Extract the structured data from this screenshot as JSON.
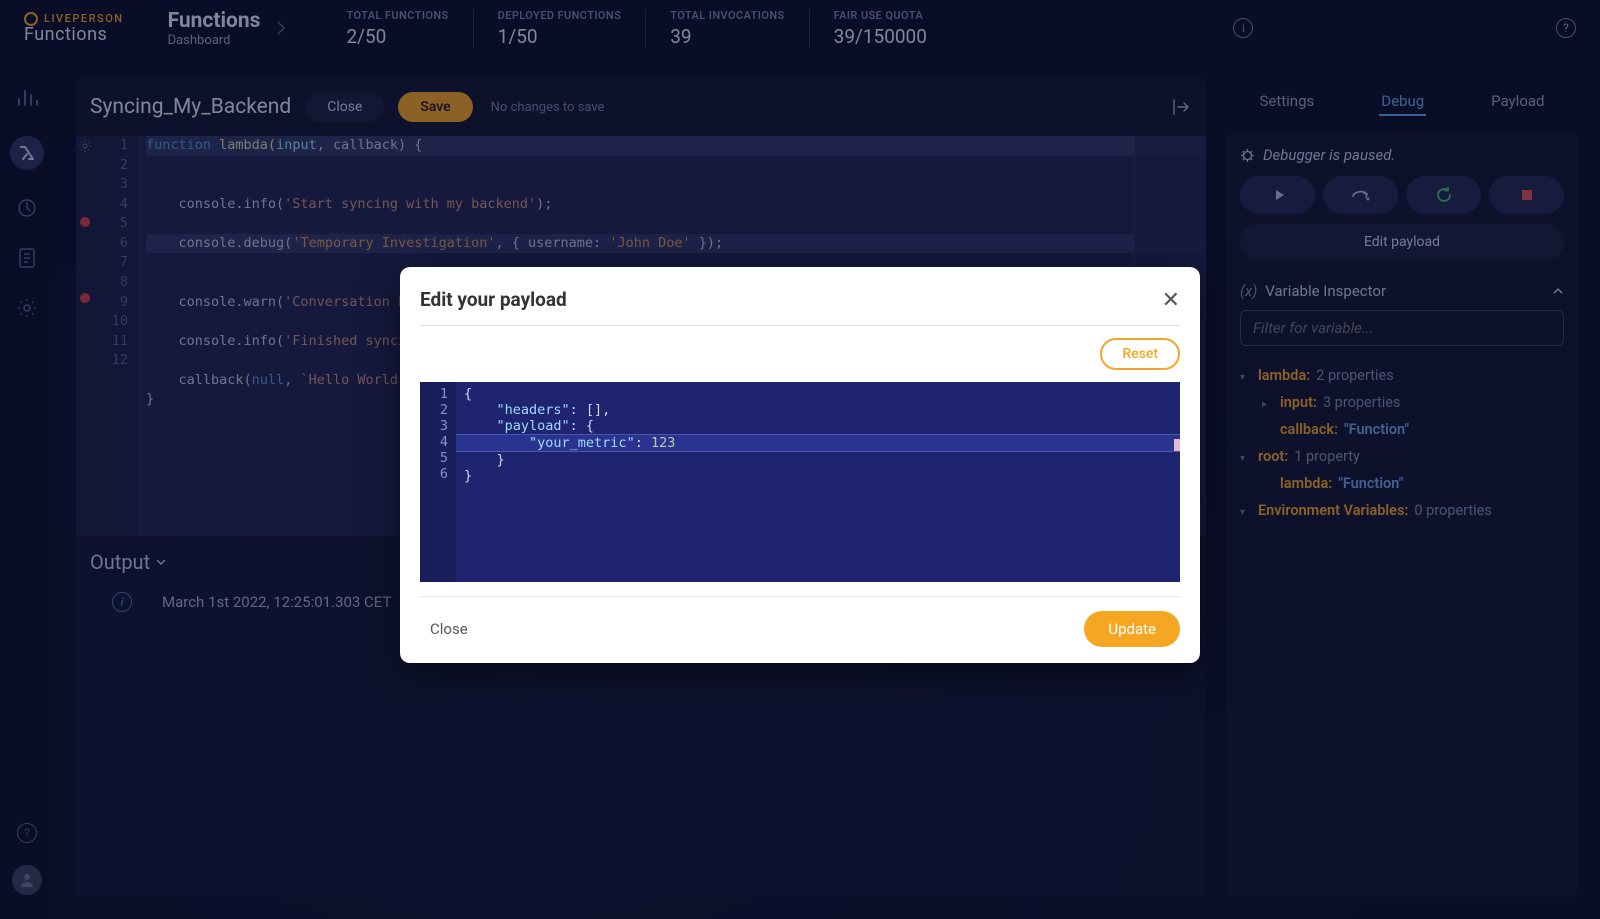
{
  "brand": {
    "top": "LIVEPERSON",
    "bottom": "Functions"
  },
  "breadcrumb": {
    "title": "Functions",
    "subtitle": "Dashboard"
  },
  "stats": [
    {
      "label": "TOTAL FUNCTIONS",
      "value": "2/50"
    },
    {
      "label": "DEPLOYED FUNCTIONS",
      "value": "1/50"
    },
    {
      "label": "TOTAL INVOCATIONS",
      "value": "39"
    },
    {
      "label": "FAIR USE QUOTA",
      "value": "39/150000"
    }
  ],
  "editor": {
    "title": "Syncing_My_Backend",
    "close": "Close",
    "save": "Save",
    "savestate": "No changes to save",
    "lines": [
      "1",
      "2",
      "3",
      "4",
      "5",
      "6",
      "7",
      "8",
      "9",
      "10",
      "11",
      "12"
    ],
    "code": {
      "l1_kw": "function",
      "l1_fn": " lambda(",
      "l1_p1": "input",
      "l1_rest": ", callback) {",
      "l3_a": "    console.info(",
      "l3_s": "'Start syncing with my backend'",
      "l3_b": ");",
      "l5_a": "    console.debug(",
      "l5_s1": "'Temporary Investigation'",
      "l5_mid": ", { username: ",
      "l5_s2": "'John Doe'",
      "l5_b": " });",
      "l7_a": "    console.warn(",
      "l7_s": "'Conversation h",
      "l9_a": "    console.info(",
      "l9_s": "'Finished synci",
      "l11_a": "    callback(",
      "l11_n": "null",
      "l11_mid": ", ",
      "l11_s": "`Hello World`",
      "l12": "}"
    }
  },
  "output": {
    "title": "Output",
    "log": "March 1st 2022, 12:25:01.303 CET"
  },
  "debug": {
    "tabs": {
      "settings": "Settings",
      "debug": "Debug",
      "payload": "Payload"
    },
    "status": "Debugger is paused.",
    "edit_payload": "Edit payload",
    "inspector_title": "Variable Inspector",
    "filter_placeholder": "Filter for variable...",
    "tree": {
      "lambda_k": "lambda:",
      "lambda_v": "2 properties",
      "input_k": "input:",
      "input_v": "3 properties",
      "callback_k": "callback:",
      "callback_v": "\"Function\"",
      "root_k": "root:",
      "root_v": "1 property",
      "root_lambda_k": "lambda:",
      "root_lambda_v": "\"Function\"",
      "env_k": "Environment Variables:",
      "env_v": "0 properties"
    }
  },
  "modal": {
    "title": "Edit your payload",
    "reset": "Reset",
    "close": "Close",
    "update": "Update",
    "lines": [
      "1",
      "2",
      "3",
      "4",
      "5",
      "6"
    ],
    "code": {
      "l1": "{",
      "l2_k": "\"headers\"",
      "l2_rest": ": [],",
      "l3_k": "\"payload\"",
      "l3_rest": ": {",
      "l4_k": "\"your_metric\"",
      "l4_mid": ": ",
      "l4_v": "123",
      "l5": "    }",
      "l6": "}"
    }
  }
}
